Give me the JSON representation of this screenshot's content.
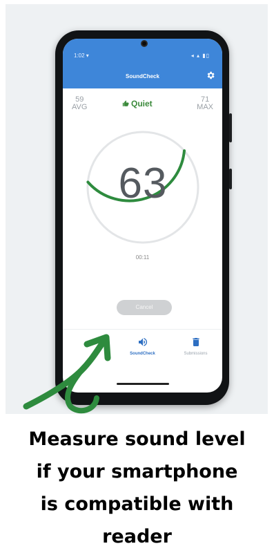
{
  "status_bar": {
    "time": "1:02 ▾",
    "icons": "◂ ▴ ▮▯"
  },
  "app": {
    "title": "SoundCheck",
    "settings_icon": "gear-icon"
  },
  "stats": {
    "avg_value": "59",
    "avg_label": "AVG",
    "max_value": "71",
    "max_label": "MAX",
    "status": "Quiet"
  },
  "gauge": {
    "reading": "63",
    "timer": "00:11",
    "level_fraction": 0.37,
    "arc_color": "#2e8b3e",
    "track_color": "#e3e5e7"
  },
  "cancel_button": {
    "label": "Cancel"
  },
  "bottom_nav": {
    "items": [
      {
        "label": "",
        "icon": "home-icon"
      },
      {
        "label": "SoundCheck",
        "icon": "sound-icon"
      },
      {
        "label": "Submissions",
        "icon": "trash-icon"
      }
    ]
  },
  "caption": {
    "lines": [
      "Measure sound level",
      "if your smartphone",
      "is compatible with",
      "reader"
    ]
  },
  "colors": {
    "accent": "#3e86d9",
    "quiet_green": "#3b8a3b",
    "arrow_green": "#2e8b3e"
  }
}
